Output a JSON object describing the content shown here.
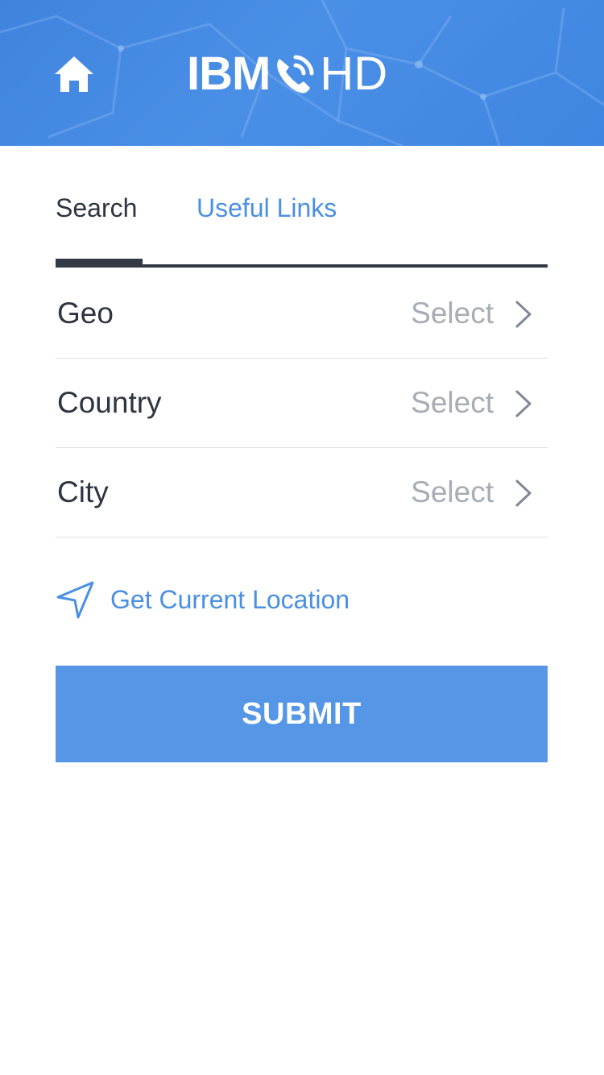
{
  "header": {
    "logo_bold": "IBM",
    "logo_light": "HD",
    "home_icon": "home-icon",
    "logo_icon": "phone-icon"
  },
  "tabs": [
    {
      "label": "Search",
      "active": true
    },
    {
      "label": "Useful Links",
      "active": false
    }
  ],
  "fields": [
    {
      "label": "Geo",
      "value": "Select"
    },
    {
      "label": "Country",
      "value": "Select"
    },
    {
      "label": "City",
      "value": "Select"
    }
  ],
  "location": {
    "label": "Get Current Location",
    "icon": "navigation-arrow-icon"
  },
  "submit": {
    "label": "SUBMIT"
  },
  "colors": {
    "header_blue": "#4a8fe6",
    "accent_blue": "#4a90e2",
    "button_blue": "#5596e6",
    "dark_text": "#2e3440",
    "placeholder_gray": "#a7adb4"
  }
}
